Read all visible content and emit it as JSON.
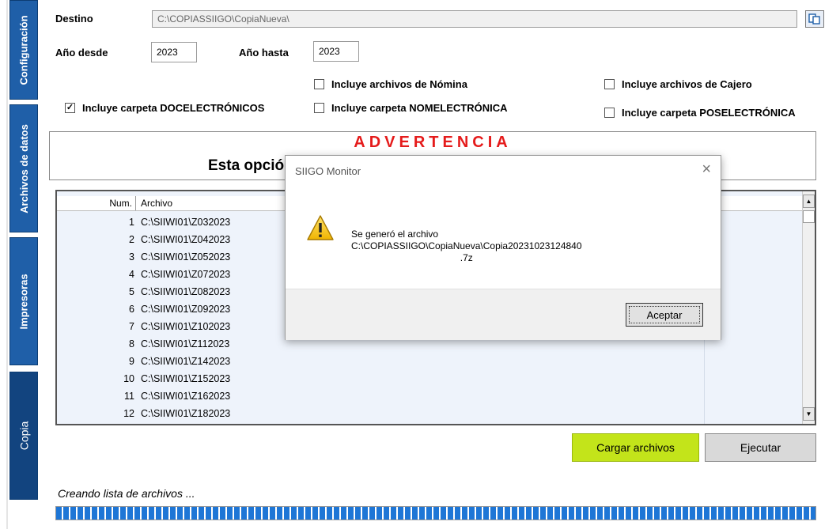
{
  "tabs": [
    {
      "label": "Configuración"
    },
    {
      "label": "Archivos de datos"
    },
    {
      "label": "Impresoras"
    },
    {
      "label": "Copia"
    }
  ],
  "form": {
    "destino_label": "Destino",
    "destino_value": "C:\\COPIASSIIGO\\CopiaNueva\\",
    "anio_desde_label": "Año desde",
    "anio_desde_value": "2023",
    "anio_hasta_label": "Año hasta",
    "anio_hasta_value": "2023"
  },
  "checkboxes": [
    {
      "label": "Incluye carpeta DOCELECTRÓNICOS",
      "checked": true
    },
    {
      "label": "Incluye archivos de Nómina",
      "checked": false
    },
    {
      "label": "Incluye carpeta NOMELECTRÓNICA",
      "checked": false
    },
    {
      "label": "Incluye archivos de Cajero",
      "checked": false
    },
    {
      "label": "Incluye carpeta POSELECTRÓNICA",
      "checked": false
    }
  ],
  "warning": {
    "title": "ADVERTENCIA",
    "text": "Esta opció"
  },
  "grid": {
    "col_num": "Num.",
    "col_archivo": "Archivo",
    "rows": [
      {
        "num": "1",
        "archivo": "C:\\SIIWI01\\Z032023"
      },
      {
        "num": "2",
        "archivo": "C:\\SIIWI01\\Z042023"
      },
      {
        "num": "3",
        "archivo": "C:\\SIIWI01\\Z052023"
      },
      {
        "num": "4",
        "archivo": "C:\\SIIWI01\\Z072023"
      },
      {
        "num": "5",
        "archivo": "C:\\SIIWI01\\Z082023"
      },
      {
        "num": "6",
        "archivo": "C:\\SIIWI01\\Z092023"
      },
      {
        "num": "7",
        "archivo": "C:\\SIIWI01\\Z102023"
      },
      {
        "num": "8",
        "archivo": "C:\\SIIWI01\\Z112023"
      },
      {
        "num": "9",
        "archivo": "C:\\SIIWI01\\Z142023"
      },
      {
        "num": "10",
        "archivo": "C:\\SIIWI01\\Z152023"
      },
      {
        "num": "11",
        "archivo": "C:\\SIIWI01\\Z162023"
      },
      {
        "num": "12",
        "archivo": "C:\\SIIWI01\\Z182023"
      }
    ]
  },
  "buttons": {
    "cargar": "Cargar archivos",
    "ejecutar": "Ejecutar"
  },
  "status": {
    "text": "Creando lista de archivos ...",
    "progress_percent": 100
  },
  "colors": {
    "tab_blue": "#1f5fa8",
    "cargar_green": "#c3e41a",
    "advert_red": "#e51b1b",
    "progress_blue": "#1e76d6"
  },
  "dialog": {
    "title": "SIIGO Monitor",
    "message_line1": "Se generó el archivo",
    "message_line2": "C:\\COPIASSIIGO\\CopiaNueva\\Copia20231023124840",
    "message_line3": ".7z",
    "ok_label": "Aceptar",
    "icon": "warning-icon"
  }
}
